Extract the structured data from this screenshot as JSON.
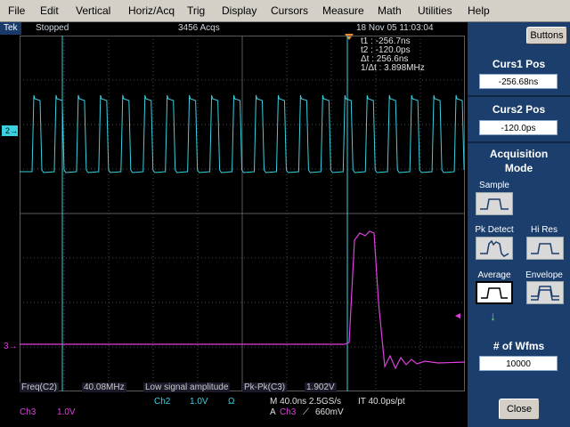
{
  "menu": [
    "File",
    "Edit",
    "Vertical",
    "Horiz/Acq",
    "Trig",
    "Display",
    "Cursors",
    "Measure",
    "Math",
    "Utilities",
    "Help"
  ],
  "status": {
    "brand": "Tek",
    "run_state": "Stopped",
    "acqs": "3456 Acqs",
    "datetime": "18 Nov 05 11:03:04"
  },
  "cursor_readout": {
    "t1": "t1 : -256.7ns",
    "t2": "t2 : -120.0ps",
    "dt": "Δt : 256.6ns",
    "inv_dt": "1/Δt : 3.898MHz"
  },
  "channel_markers": {
    "ch2": "2",
    "ch3": "3"
  },
  "measurement": {
    "freq_label": "Freq(C2)",
    "freq_value": "40.08MHz",
    "freq_note": "Low signal amplitude",
    "pkpk_label": "Pk-Pk(C3)",
    "pkpk_value": "1.902V"
  },
  "bottom": {
    "ch2_name": "Ch2",
    "ch2_scale": "1.0V",
    "ch2_coupling": "Ω",
    "timebase": "M 40.0ns 2.5GS/s",
    "record": "IT 40.0ps/pt",
    "trig_prefix": "A",
    "trig_channel": "Ch3",
    "trig_slope": "⟋",
    "trig_level": "660mV",
    "ch3_name": "Ch3",
    "ch3_scale": "1.0V"
  },
  "panel": {
    "buttons_label": "Buttons",
    "curs1_title": "Curs1 Pos",
    "curs1_value": "-256.68ns",
    "curs2_title": "Curs2 Pos",
    "curs2_value": "-120.0ps",
    "acq_title_1": "Acquisition",
    "acq_title_2": "Mode",
    "modes": {
      "sample": "Sample",
      "pk_detect": "Pk Detect",
      "hi_res": "Hi Res",
      "average": "Average",
      "envelope": "Envelope"
    },
    "selected_mode": "Average",
    "wfms_title": "# of Wfms",
    "wfms_value": "10000",
    "close_label": "Close"
  },
  "colors": {
    "ch2": "#3ad0e0",
    "ch3": "#e040e0",
    "panel": "#1c3e6c",
    "trigger": "#f28a2a"
  }
}
